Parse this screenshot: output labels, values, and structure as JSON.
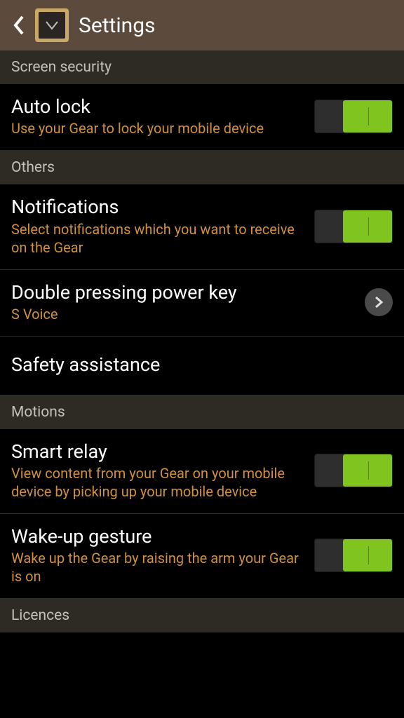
{
  "header": {
    "title": "Settings"
  },
  "sections": {
    "screen_security": {
      "label": "Screen security"
    },
    "others": {
      "label": "Others"
    },
    "motions": {
      "label": "Motions"
    },
    "licences": {
      "label": "Licences"
    }
  },
  "items": {
    "auto_lock": {
      "title": "Auto lock",
      "subtitle": "Use your Gear to lock your mobile device"
    },
    "notifications": {
      "title": "Notifications",
      "subtitle": "Select notifications which you want to receive on the Gear"
    },
    "double_press": {
      "title": "Double pressing power key",
      "subtitle": "S Voice"
    },
    "safety": {
      "title": "Safety assistance"
    },
    "smart_relay": {
      "title": "Smart relay",
      "subtitle": "View content from your Gear on your mobile device by picking up your mobile device"
    },
    "wake_up": {
      "title": "Wake-up gesture",
      "subtitle": "Wake up the Gear by raising the arm your Gear is on"
    }
  }
}
